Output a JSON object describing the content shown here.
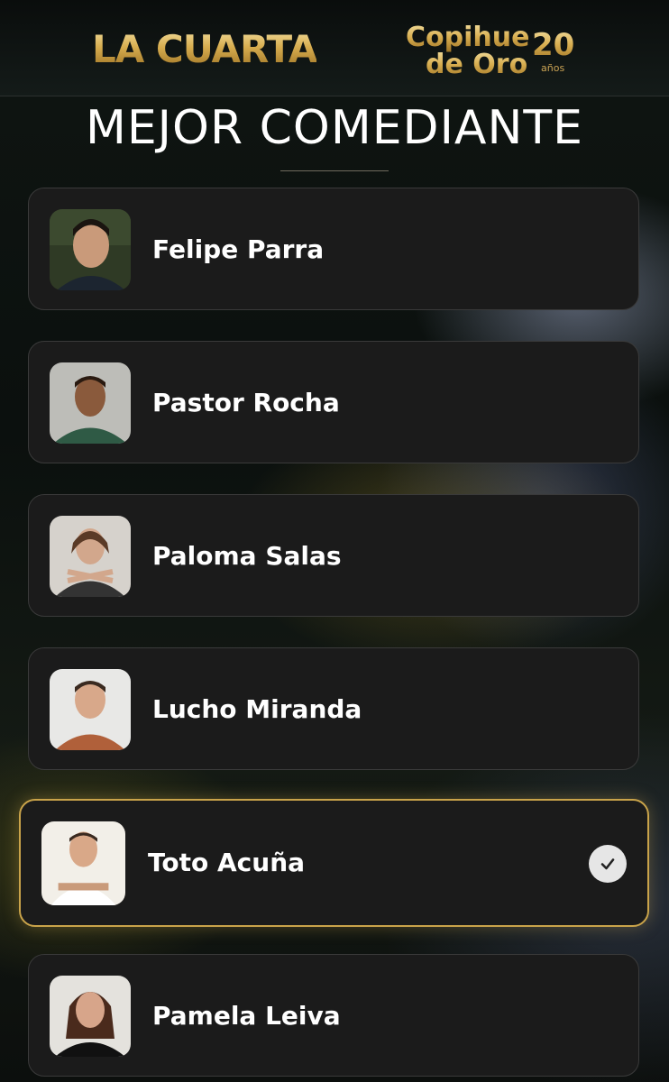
{
  "header": {
    "brand_left": "LA CUARTA",
    "brand_right_line1": "Copihue",
    "brand_right_line2": "de Oro",
    "brand_right_number": "20",
    "brand_right_sub": "años"
  },
  "category_title": "MEJOR COMEDIANTE",
  "colors": {
    "accent_gold": "#c9a34a",
    "card_bg": "#1b1b1b",
    "text": "#ffffff"
  },
  "nominees": [
    {
      "name": "Felipe Parra",
      "selected": false,
      "icon": "avatar-photo"
    },
    {
      "name": "Pastor Rocha",
      "selected": false,
      "icon": "avatar-photo"
    },
    {
      "name": "Paloma Salas",
      "selected": false,
      "icon": "avatar-photo"
    },
    {
      "name": "Lucho Miranda",
      "selected": false,
      "icon": "avatar-photo"
    },
    {
      "name": "Toto Acuña",
      "selected": true,
      "icon": "checkmark-icon"
    },
    {
      "name": "Pamela Leiva",
      "selected": false,
      "icon": "avatar-photo"
    }
  ]
}
